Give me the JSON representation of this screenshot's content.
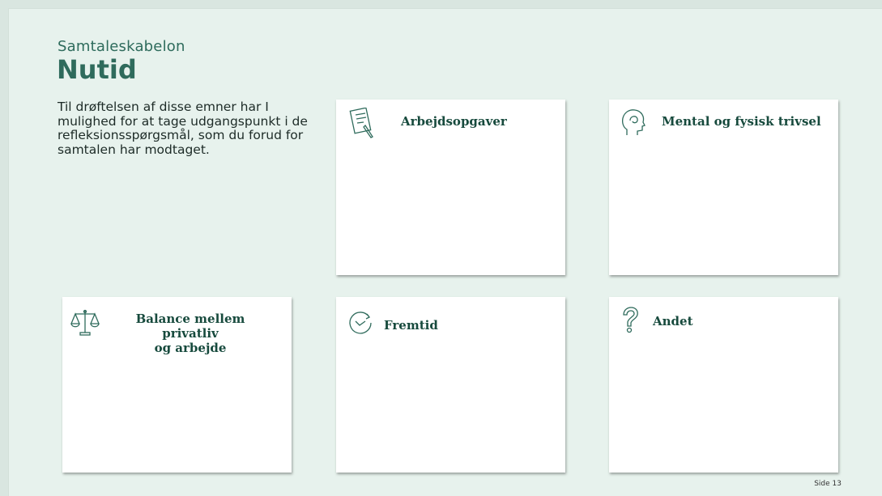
{
  "header": {
    "subtitle": "Samtaleskabelon",
    "title": "Nutid"
  },
  "intro": {
    "text": "Til drøftelsen af disse emner har I mulighed for at tage udgangspunkt i de refleksionsspørgsmål, som du forud for samtalen har modtaget."
  },
  "cards": [
    {
      "label": "Arbejdsopgaver",
      "icon": "document-pen-icon"
    },
    {
      "label": "Mental og fysisk trivsel",
      "icon": "head-profile-icon"
    },
    {
      "label_line1": "Balance mellem privatliv",
      "label_line2": "og arbejde",
      "icon": "scales-icon"
    },
    {
      "label": "Fremtid",
      "icon": "clock-arrow-icon"
    },
    {
      "label": "Andet",
      "icon": "question-mark-icon"
    }
  ],
  "footer": {
    "page": "Side  13"
  },
  "colors": {
    "accent": "#2f6b5c",
    "background": "#e7f2ed",
    "card": "#ffffff"
  }
}
